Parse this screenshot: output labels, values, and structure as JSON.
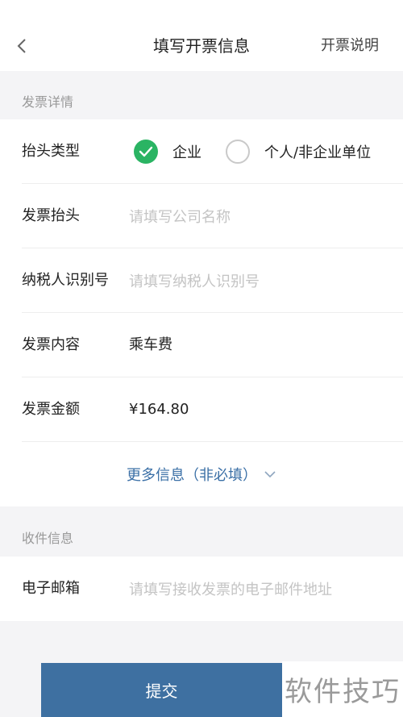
{
  "header": {
    "title": "填写开票信息",
    "help_link": "开票说明"
  },
  "invoice_section": {
    "title": "发票详情",
    "header_type": {
      "label": "抬头类型",
      "options": [
        {
          "label": "企业",
          "selected": true
        },
        {
          "label": "个人/非企业单位",
          "selected": false
        }
      ]
    },
    "invoice_title": {
      "label": "发票抬头",
      "placeholder": "请填写公司名称"
    },
    "taxpayer_id": {
      "label": "纳税人识别号",
      "placeholder": "请填写纳税人识别号"
    },
    "content": {
      "label": "发票内容",
      "value": "乘车费"
    },
    "amount": {
      "label": "发票金额",
      "value": "¥164.80"
    },
    "more_info": "更多信息（非必填）"
  },
  "recipient_section": {
    "title": "收件信息",
    "email": {
      "label": "电子邮箱",
      "placeholder": "请填写接收发票的电子邮件地址"
    }
  },
  "submit_label": "提交",
  "watermark": "软件技巧",
  "colors": {
    "accent_green": "#2ab463",
    "submit_blue": "#3e70a1",
    "link_blue": "#3a6fa6"
  },
  "icons": {
    "back": "chevron-left-icon",
    "check": "check-icon",
    "expand": "chevron-down-icon"
  }
}
